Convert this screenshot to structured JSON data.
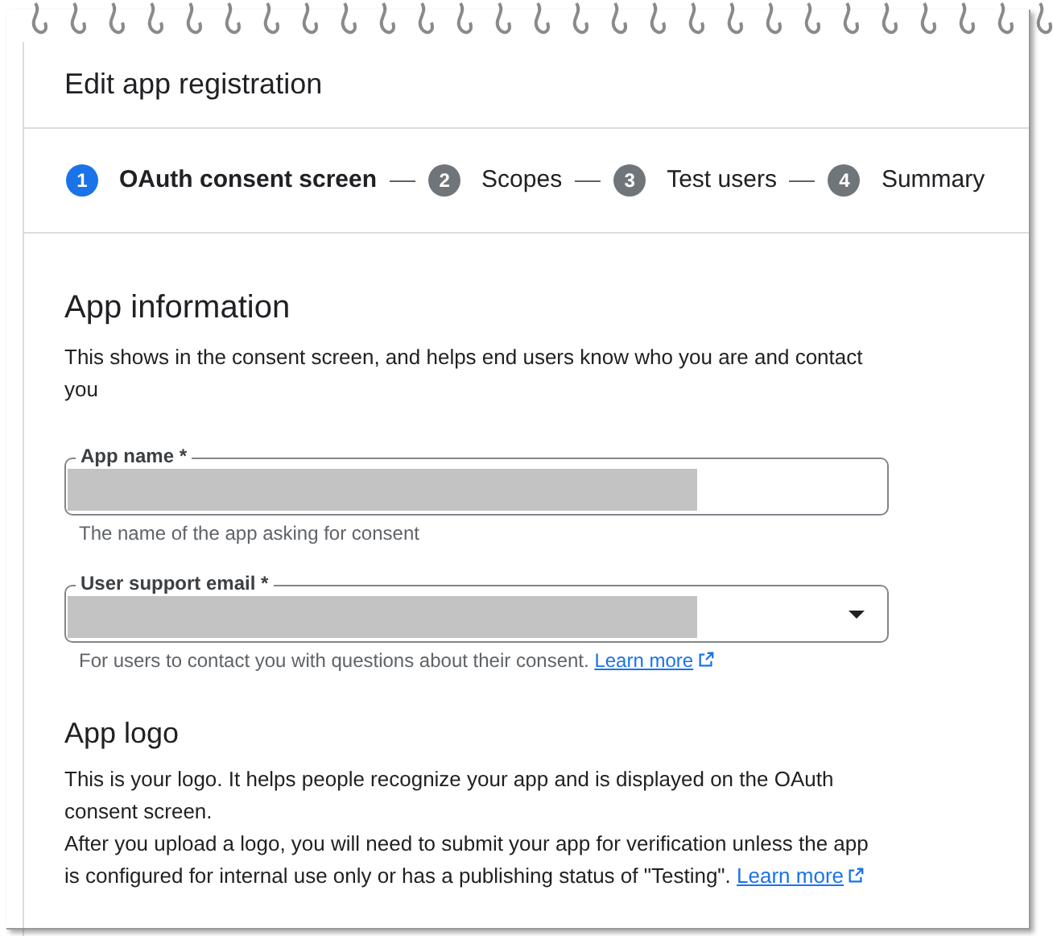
{
  "dialog": {
    "title": "Edit app registration"
  },
  "steps": [
    {
      "number": "1",
      "label": "OAuth consent screen",
      "selected": true
    },
    {
      "number": "2",
      "label": "Scopes",
      "selected": false
    },
    {
      "number": "3",
      "label": "Test users",
      "selected": false
    },
    {
      "number": "4",
      "label": "Summary",
      "selected": false
    }
  ],
  "app_information": {
    "heading": "App information",
    "description": "This shows in the consent screen, and helps end users know who you are and contact you",
    "fields": [
      {
        "kind": "text",
        "label": "App name *",
        "hint": "The name of the app asking for consent"
      },
      {
        "kind": "dropdown",
        "label": "User support email *",
        "hint": "For users to contact you with questions about their consent.",
        "link": "Learn more"
      }
    ]
  },
  "app_logo": {
    "heading": "App logo",
    "paragraphs": [
      "This is your logo. It helps people recognize your app and is displayed on the OAuth consent screen.",
      "After you upload a logo, you will need to submit your app for verification unless the app is configured for internal use only or has a publishing status of \"Testing\"."
    ],
    "link": "Learn more"
  }
}
